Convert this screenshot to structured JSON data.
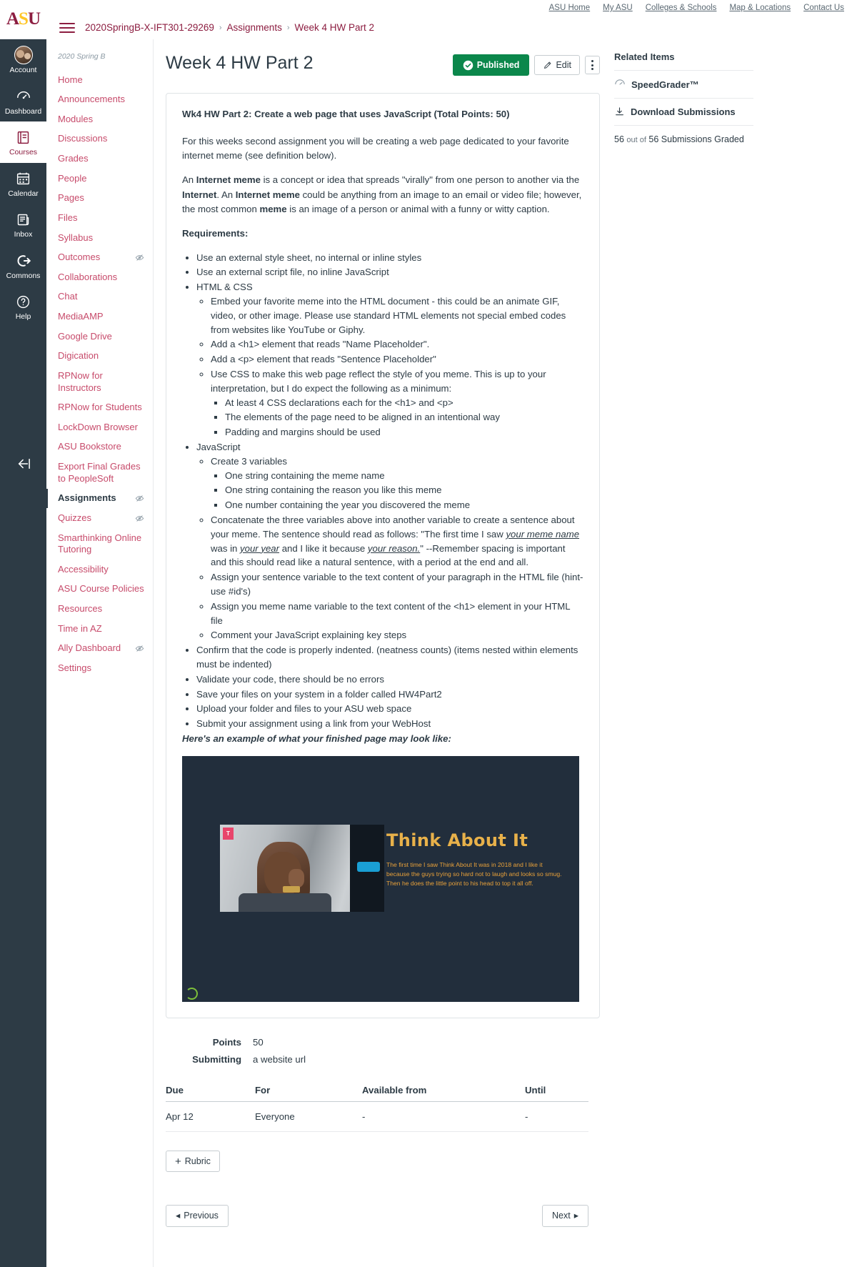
{
  "asu_utility_links": [
    "ASU Home",
    "My ASU",
    "Colleges & Schools",
    "Map & Locations",
    "Contact Us"
  ],
  "brand": {
    "logo_text": "ASU",
    "primary": "#8C1D40",
    "gold": "#FFC627",
    "published_green": "#0B874B"
  },
  "global_nav": [
    {
      "label": "Account",
      "icon": "avatar-icon",
      "active": false
    },
    {
      "label": "Dashboard",
      "icon": "dashboard-icon",
      "active": false
    },
    {
      "label": "Courses",
      "icon": "courses-book-icon",
      "active": true
    },
    {
      "label": "Calendar",
      "icon": "calendar-icon",
      "active": false
    },
    {
      "label": "Inbox",
      "icon": "inbox-icon",
      "active": false
    },
    {
      "label": "Commons",
      "icon": "commons-arrow-icon",
      "active": false
    },
    {
      "label": "Help",
      "icon": "help-question-icon",
      "active": false
    }
  ],
  "breadcrumb": {
    "course": "2020SpringB-X-IFT301-29269",
    "section": "Assignments",
    "current": "Week 4 HW Part 2",
    "separator": "›"
  },
  "course_nav": {
    "term": "2020 Spring B",
    "items": [
      {
        "label": "Home",
        "hidden": false,
        "active": false
      },
      {
        "label": "Announcements",
        "hidden": false,
        "active": false
      },
      {
        "label": "Modules",
        "hidden": false,
        "active": false
      },
      {
        "label": "Discussions",
        "hidden": false,
        "active": false
      },
      {
        "label": "Grades",
        "hidden": false,
        "active": false
      },
      {
        "label": "People",
        "hidden": false,
        "active": false
      },
      {
        "label": "Pages",
        "hidden": false,
        "active": false
      },
      {
        "label": "Files",
        "hidden": false,
        "active": false
      },
      {
        "label": "Syllabus",
        "hidden": false,
        "active": false
      },
      {
        "label": "Outcomes",
        "hidden": true,
        "active": false
      },
      {
        "label": "Collaborations",
        "hidden": false,
        "active": false
      },
      {
        "label": "Chat",
        "hidden": false,
        "active": false
      },
      {
        "label": "MediaAMP",
        "hidden": false,
        "active": false
      },
      {
        "label": "Google Drive",
        "hidden": false,
        "active": false
      },
      {
        "label": "Digication",
        "hidden": false,
        "active": false
      },
      {
        "label": "RPNow for Instructors",
        "hidden": false,
        "active": false
      },
      {
        "label": "RPNow for Students",
        "hidden": false,
        "active": false
      },
      {
        "label": "LockDown Browser",
        "hidden": false,
        "active": false
      },
      {
        "label": "ASU Bookstore",
        "hidden": false,
        "active": false
      },
      {
        "label": "Export Final Grades to PeopleSoft",
        "hidden": false,
        "active": false
      },
      {
        "label": "Assignments",
        "hidden": true,
        "active": true
      },
      {
        "label": "Quizzes",
        "hidden": true,
        "active": false
      },
      {
        "label": "Smarthinking Online Tutoring",
        "hidden": false,
        "active": false
      },
      {
        "label": "Accessibility",
        "hidden": false,
        "active": false
      },
      {
        "label": "ASU Course Policies",
        "hidden": false,
        "active": false
      },
      {
        "label": "Resources",
        "hidden": false,
        "active": false
      },
      {
        "label": "Time in AZ",
        "hidden": false,
        "active": false
      },
      {
        "label": "Ally Dashboard",
        "hidden": true,
        "active": false
      },
      {
        "label": "Settings",
        "hidden": false,
        "active": false
      }
    ]
  },
  "assignment": {
    "title": "Week 4 HW Part 2",
    "published_label": "Published",
    "edit_label": "Edit",
    "heading": "Wk4 HW Part 2: Create a web page that uses JavaScript (Total Points: 50)",
    "intro": "For this weeks second assignment you will be creating  a web page dedicated to your favorite internet meme (see definition below).",
    "definition_parts": [
      {
        "text": "An ",
        "bold": false
      },
      {
        "text": "Internet meme",
        "bold": true
      },
      {
        "text": " is a concept or idea that spreads \"virally\" from one person to another via the ",
        "bold": false
      },
      {
        "text": "Internet",
        "bold": true
      },
      {
        "text": ". An ",
        "bold": false
      },
      {
        "text": "Internet meme",
        "bold": true
      },
      {
        "text": " could be anything from an image to an email or video file; however, the most common ",
        "bold": false
      },
      {
        "text": "meme",
        "bold": true
      },
      {
        "text": " is an image of a person or animal with a funny or witty caption.",
        "bold": false
      }
    ],
    "requirements_label": "Requirements:",
    "requirements": [
      {
        "text": "Use an external style sheet, no internal or inline styles",
        "children": []
      },
      {
        "text": "Use an external script file, no inline JavaScript",
        "children": []
      },
      {
        "text": "HTML & CSS",
        "children": [
          {
            "text": "Embed your favorite meme into the HTML document - this could be  an animate GIF, video, or other image. Please use standard HTML elements not special embed codes from websites like YouTube or Giphy.",
            "children": []
          },
          {
            "text": "Add a  <h1> element that reads \"Name Placeholder\".",
            "children": []
          },
          {
            "text": "Add a <p> element that reads \"Sentence Placeholder\"",
            "children": []
          },
          {
            "text": "Use CSS to make this web page reflect the style of you meme. This is up to your interpretation, but I do expect the following as a minimum:",
            "children": [
              {
                "text": "At least 4 CSS declarations each for the <h1> and <p>",
                "children": []
              },
              {
                "text": "The elements of the page need to be aligned in an intentional way",
                "children": []
              },
              {
                "text": "Padding and margins should be used",
                "children": []
              }
            ]
          }
        ]
      },
      {
        "text": "JavaScript",
        "children": [
          {
            "text": "Create 3 variables",
            "children": [
              {
                "text": "One string containing the meme name",
                "children": []
              },
              {
                "text": "One string containing the reason you like this meme",
                "children": []
              },
              {
                "text": "One number containing the year you discovered the meme",
                "children": []
              }
            ]
          },
          {
            "text": "Concatenate the three variables above into another variable to create a sentence about your meme. The sentence should read as follows: \"The first time I saw your meme name was in your year and I like it because your reason.\" --Remember spacing is important and  this should read like a natural sentence, with a period at the end and all.",
            "children": []
          },
          {
            "text": "Assign your sentence variable to the text content of your paragraph in the HTML file (hint- use #id's)",
            "children": []
          },
          {
            "text": "Assign you meme name variable to the text content of the  <h1>  element in your HTML file",
            "children": []
          },
          {
            "text": "Comment your JavaScript explaining  key steps",
            "children": []
          }
        ]
      },
      {
        "text": "Confirm that the code is properly indented. (neatness counts) (items nested within elements must be indented)",
        "children": []
      },
      {
        "text": "Validate your code, there should be no errors",
        "children": []
      },
      {
        "text": "Save your files on your system in a folder called HW4Part2",
        "children": []
      },
      {
        "text": "Upload your folder and files to your ASU web space",
        "children": []
      },
      {
        "text": "Submit your assignment using a link from your WebHost",
        "children": []
      }
    ],
    "example_caption": "Here's an example of what your finished page may look like:",
    "example_preview": {
      "heading": "Think About It",
      "paragraph": "The first time I saw Think About It was in 2018 and I like it because the guys trying so hard not to laugh and looks so smug. Then he does the little point to his head to top it all off.",
      "bg_color": "#222e3c",
      "heading_color": "#E8B14A"
    },
    "details": [
      {
        "label": "Points",
        "value": "50"
      },
      {
        "label": "Submitting",
        "value": "a website url"
      }
    ],
    "due_table": {
      "headers": [
        "Due",
        "For",
        "Available from",
        "Until"
      ],
      "rows": [
        [
          "Apr 12",
          "Everyone",
          "-",
          "-"
        ]
      ]
    },
    "rubric_button": "Rubric",
    "previous_button": "Previous",
    "next_button": "Next"
  },
  "right_rail": {
    "title": "Related Items",
    "items": [
      {
        "label": "SpeedGrader™",
        "icon": "speedgrader-icon"
      },
      {
        "label": "Download Submissions",
        "icon": "download-icon"
      }
    ],
    "graded_note": {
      "graded": "56",
      "mid": "out of",
      "total": "56",
      "suffix": "Submissions Graded"
    }
  }
}
